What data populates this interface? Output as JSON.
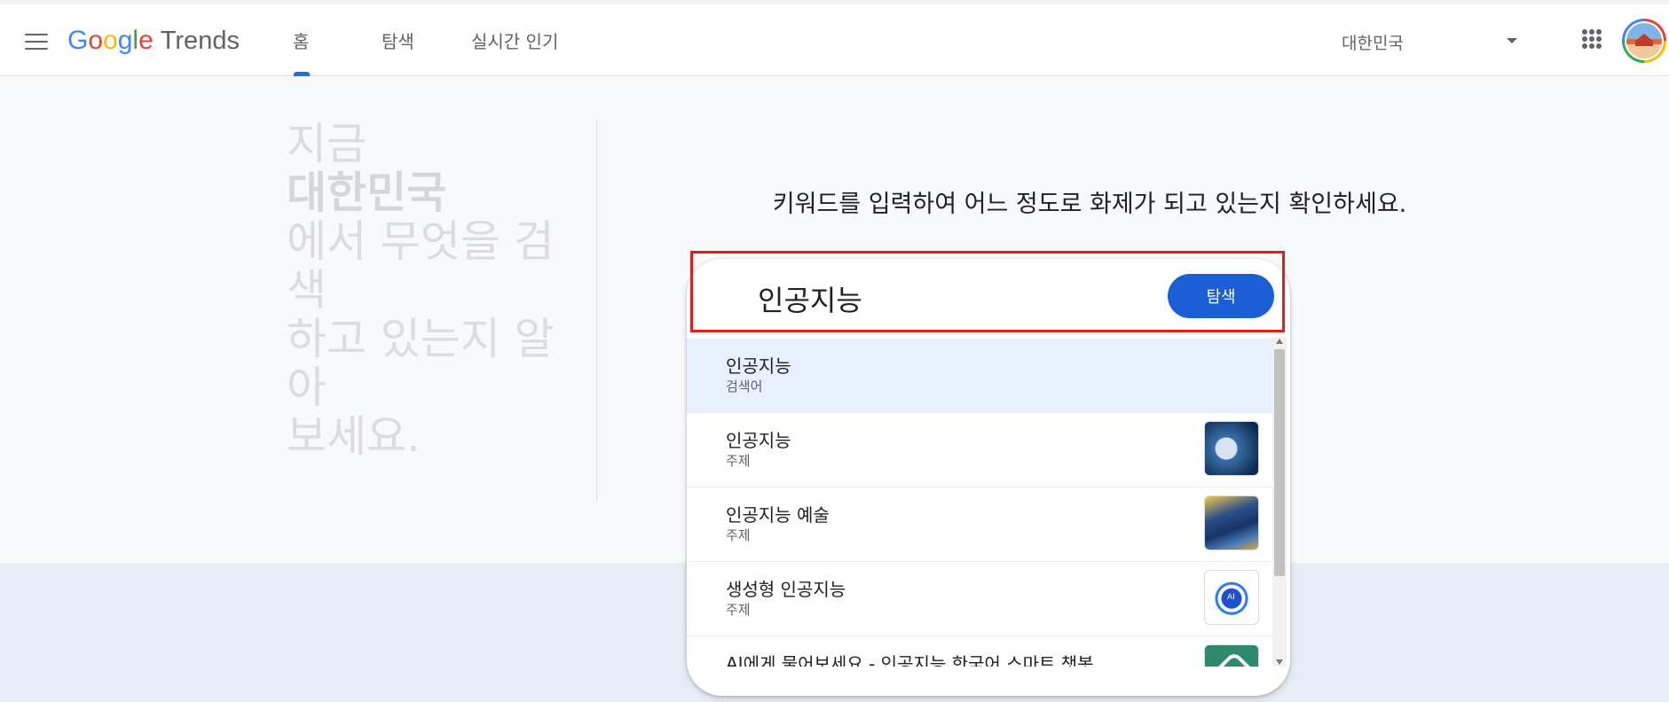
{
  "header": {
    "logo": {
      "google_letters": [
        "G",
        "o",
        "o",
        "g",
        "l",
        "e"
      ],
      "product": "Trends"
    },
    "tabs": [
      {
        "label": "홈",
        "active": true
      },
      {
        "label": "탐색",
        "active": false
      },
      {
        "label": "실시간 인기",
        "active": false
      }
    ],
    "country": "대한민국"
  },
  "hero": {
    "line1": "지금",
    "line2": "대한민국",
    "line3": "에서 무엇을 검색",
    "line4": "하고 있는지 알아",
    "line5": "보세요.",
    "prompt": "키워드를 입력하여 어느 정도로 화제가 되고 있는지 확인하세요."
  },
  "search": {
    "value": "인공지능",
    "button_label": "탐색"
  },
  "suggestions": [
    {
      "title": "인공지능",
      "type": "검색어",
      "thumbnail": null,
      "selected": true
    },
    {
      "title": "인공지능",
      "type": "주제",
      "thumbnail": "robot-face-image",
      "selected": false
    },
    {
      "title": "인공지능 예술",
      "type": "주제",
      "thumbnail": "starry-night-image",
      "selected": false
    },
    {
      "title": "생성형 인공지능",
      "type": "주제",
      "thumbnail": "ai-diagram-image",
      "selected": false
    },
    {
      "title": "AI에게 물어보세요 - 인공지능 한국어 스마트 챗봇",
      "type": "",
      "thumbnail": "chatbot-app-icon",
      "selected": false
    }
  ],
  "colors": {
    "accent": "#1a73e8",
    "button": "#1a5fd6",
    "highlight": "#e51b1b",
    "selected_row": "#e8f0fe"
  }
}
